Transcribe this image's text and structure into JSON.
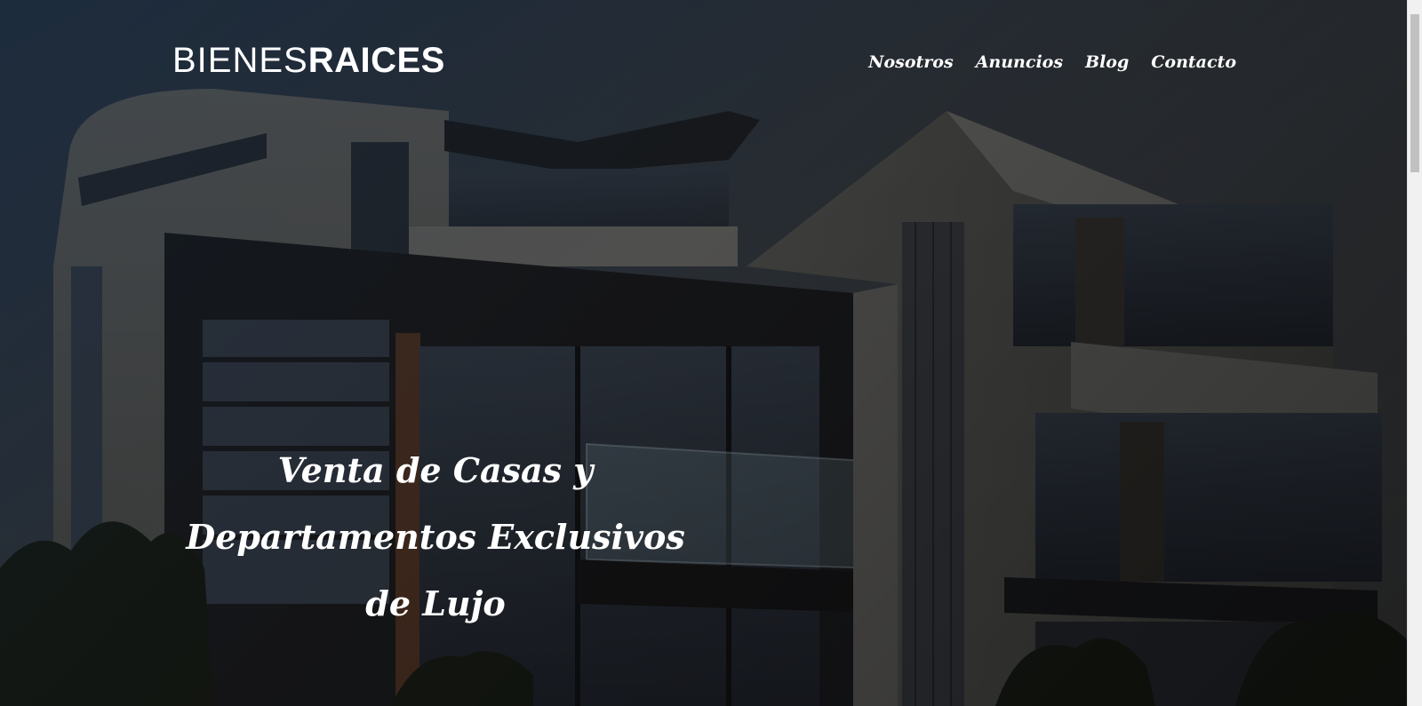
{
  "brand": {
    "light": "BIENES",
    "bold": "RAICES"
  },
  "nav": {
    "items": [
      {
        "label": "Nosotros"
      },
      {
        "label": "Anuncios"
      },
      {
        "label": "Blog"
      },
      {
        "label": "Contacto"
      }
    ]
  },
  "hero": {
    "heading": "Venta de Casas y Departamentos Exclusivos de Lujo",
    "background": "modern-house-photo"
  }
}
